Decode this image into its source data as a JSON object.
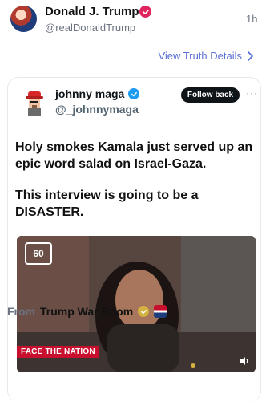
{
  "header": {
    "display_name": "Donald J. Trump",
    "handle": "@realDonaldTrump",
    "time": "1h",
    "view_link": "View Truth Details"
  },
  "card": {
    "name": "johnny maga",
    "handle": "@_johnnymaga",
    "follow_button": "Follow back",
    "more": "···",
    "post_line_1": "Holy smokes Kamala just served up an epic word salad on Israel-Gaza.",
    "post_line_2": "This interview is going to be a DISASTER.",
    "video": {
      "logo_text": "60",
      "badge_text": "FACE THE NATION"
    }
  },
  "from": {
    "label": "From",
    "name": "Trump War Room"
  },
  "colors": {
    "accent_link": "#5b6fd6",
    "verified_blue": "#1d9bf0",
    "verified_pink": "#e0245e",
    "face_badge_red": "#c8102e"
  },
  "icons": {
    "verified": "check-icon",
    "chevron": "chevron-right-icon",
    "sound": "sound-icon"
  }
}
